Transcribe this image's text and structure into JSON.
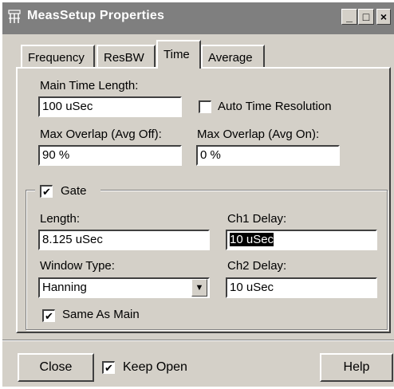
{
  "window": {
    "title": "MeasSetup Properties",
    "controls": [
      "_",
      "□",
      "×"
    ]
  },
  "tabs": [
    {
      "label": "Frequency",
      "active": false
    },
    {
      "label": "ResBW",
      "active": false
    },
    {
      "label": "Time",
      "active": true
    },
    {
      "label": "Average",
      "active": false
    }
  ],
  "time_tab": {
    "main_time_length_label": "Main Time Length:",
    "main_time_length_value": "100 uSec",
    "auto_time_resolution_label": "Auto Time Resolution",
    "auto_time_resolution_checked": false,
    "max_overlap_avg_off_label": "Max Overlap (Avg Off):",
    "max_overlap_avg_off_value": "90 %",
    "max_overlap_avg_on_label": "Max Overlap (Avg On):",
    "max_overlap_avg_on_value": "0 %"
  },
  "gate": {
    "label": "Gate",
    "checked": true,
    "length_label": "Length:",
    "length_value": "8.125 uSec",
    "ch1_delay_label": "Ch1 Delay:",
    "ch1_delay_value": "10 uSec",
    "window_type_label": "Window Type:",
    "window_type_value": "Hanning",
    "ch2_delay_label": "Ch2 Delay:",
    "ch2_delay_value": "10 uSec",
    "same_as_main_label": "Same As Main",
    "same_as_main_checked": true
  },
  "footer": {
    "close_label": "Close",
    "keep_open_label": "Keep Open",
    "keep_open_checked": true,
    "help_label": "Help"
  },
  "colors": {
    "face": "#d4d0c8",
    "titlebar_inactive": "#7f7f7f",
    "title_text": "#ffffff",
    "selection": "#000000"
  },
  "icons": {
    "app": "network-grid-icon",
    "check": "checkmark-icon",
    "dropdown": "triangle-down-icon"
  }
}
